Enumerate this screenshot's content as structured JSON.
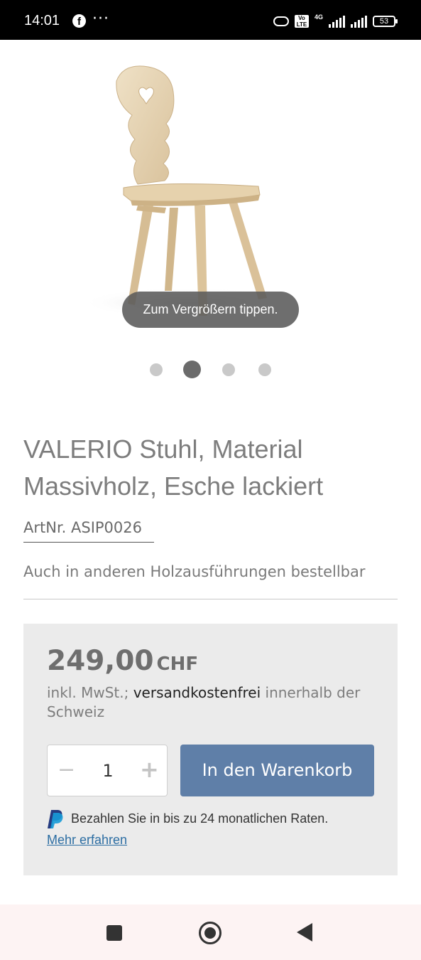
{
  "status_bar": {
    "time": "14:01",
    "icons": [
      "facebook-icon",
      "more-icon",
      "hotspot-icon",
      "volte-icon",
      "signal-icon",
      "battery-icon"
    ],
    "network": "4G",
    "volte": "Vo LTE",
    "battery": "53"
  },
  "gallery": {
    "zoom_hint": "Zum Vergrößern tippen.",
    "slides": 4,
    "active_slide": 2
  },
  "product": {
    "title": "VALERIO Stuhl, Material Massivholz, Esche lackiert",
    "article_number": "ArtNr. ASIP0026",
    "availability_note": "Auch in anderen Holzausführungen bestellbar"
  },
  "buybox": {
    "price": "249,00",
    "currency": "CHF",
    "tax_prefix": "inkl. MwSt.; ",
    "tax_emphasis": "versandkostenfrei",
    "tax_suffix": " innerhalb der Schweiz",
    "quantity": "1",
    "quantity_minus": "−",
    "quantity_plus": "+",
    "add_to_cart_label": "In den Warenkorb",
    "paypal_text": "Bezahlen Sie in bis zu 24 monatlichen Raten.",
    "paypal_link": "Mehr erfahren"
  },
  "colors": {
    "cart_button": "#5f7fa8",
    "buybox_bg": "#ebebeb",
    "link": "#2d6ea3"
  }
}
